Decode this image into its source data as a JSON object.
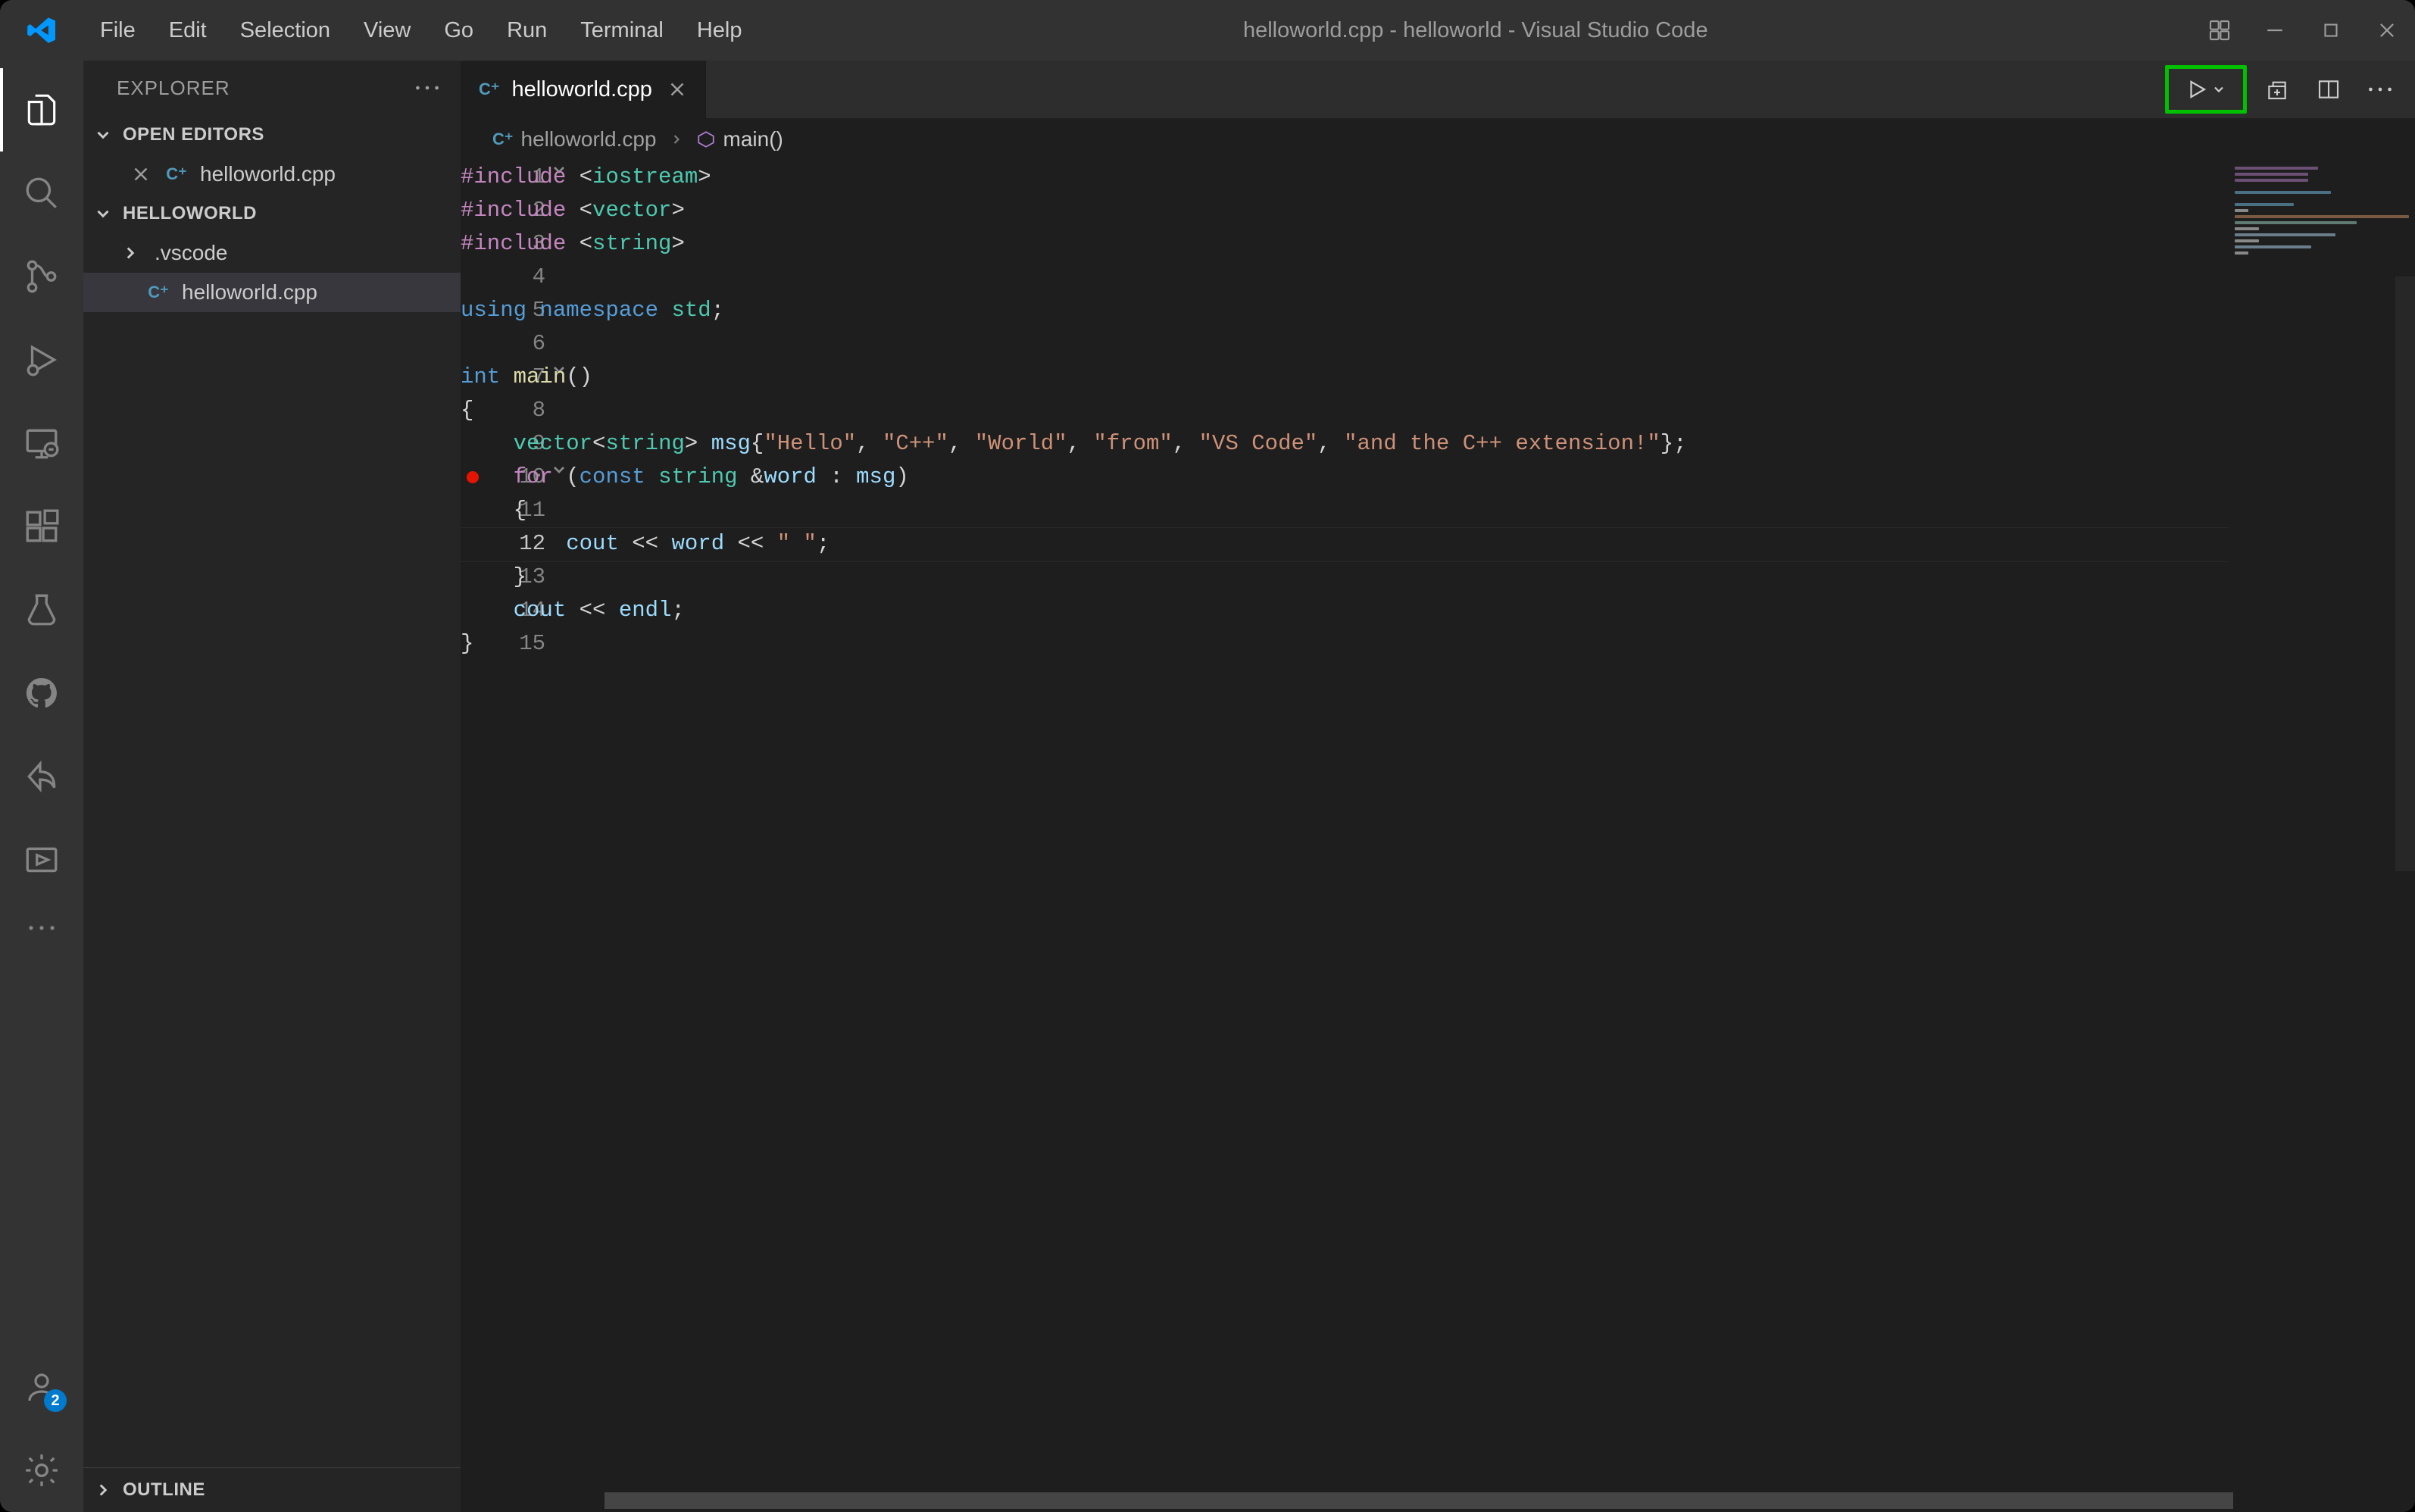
{
  "window": {
    "title": "helloworld.cpp - helloworld - Visual Studio Code"
  },
  "menu": {
    "items": [
      "File",
      "Edit",
      "Selection",
      "View",
      "Go",
      "Run",
      "Terminal",
      "Help"
    ]
  },
  "activity": {
    "items": [
      {
        "id": "explorer",
        "label": "Explorer",
        "active": true
      },
      {
        "id": "search",
        "label": "Search"
      },
      {
        "id": "scm",
        "label": "Source Control"
      },
      {
        "id": "run",
        "label": "Run and Debug"
      },
      {
        "id": "remote",
        "label": "Remote Explorer"
      },
      {
        "id": "extensions",
        "label": "Extensions"
      },
      {
        "id": "testing",
        "label": "Testing"
      },
      {
        "id": "github",
        "label": "GitHub"
      },
      {
        "id": "liveshare",
        "label": "Live Share"
      },
      {
        "id": "project",
        "label": "Project Manager"
      }
    ],
    "overflow_label": "...",
    "accounts_badge": "2"
  },
  "explorer": {
    "title": "EXPLORER",
    "open_editors_label": "OPEN EDITORS",
    "open_editors": [
      {
        "name": "helloworld.cpp",
        "icon": "cpp"
      }
    ],
    "workspace_label": "HELLOWORLD",
    "tree": [
      {
        "type": "folder",
        "name": ".vscode",
        "expanded": false
      },
      {
        "type": "file",
        "name": "helloworld.cpp",
        "icon": "cpp",
        "selected": true
      }
    ],
    "outline_label": "OUTLINE"
  },
  "tabs": {
    "open": [
      {
        "name": "helloworld.cpp",
        "icon": "cpp",
        "active": true
      }
    ]
  },
  "breadcrumb": {
    "file": "helloworld.cpp",
    "symbol": "main()"
  },
  "editor": {
    "current_line": 12,
    "breakpoint_hover_line": 10,
    "lines": [
      {
        "n": 1,
        "fold": "v",
        "tokens": [
          [
            "ctrl",
            "#include "
          ],
          [
            "op",
            "<"
          ],
          [
            "type",
            "iostream"
          ],
          [
            "op",
            ">"
          ]
        ]
      },
      {
        "n": 2,
        "tokens": [
          [
            "ctrl",
            "#include "
          ],
          [
            "op",
            "<"
          ],
          [
            "type",
            "vector"
          ],
          [
            "op",
            ">"
          ]
        ]
      },
      {
        "n": 3,
        "tokens": [
          [
            "ctrl",
            "#include "
          ],
          [
            "op",
            "<"
          ],
          [
            "type",
            "string"
          ],
          [
            "op",
            ">"
          ]
        ]
      },
      {
        "n": 4,
        "tokens": []
      },
      {
        "n": 5,
        "tokens": [
          [
            "kw",
            "using "
          ],
          [
            "kw",
            "namespace "
          ],
          [
            "type",
            "std"
          ],
          [
            "op",
            ";"
          ]
        ]
      },
      {
        "n": 6,
        "tokens": []
      },
      {
        "n": 7,
        "fold": "v",
        "tokens": [
          [
            "kw",
            "int "
          ],
          [
            "fn",
            "main"
          ],
          [
            "op",
            "()"
          ]
        ]
      },
      {
        "n": 8,
        "tokens": [
          [
            "op",
            "{"
          ]
        ]
      },
      {
        "n": 9,
        "tokens": [
          [
            "op",
            "    "
          ],
          [
            "type",
            "vector"
          ],
          [
            "op",
            "<"
          ],
          [
            "type",
            "string"
          ],
          [
            "op",
            "> "
          ],
          [
            "var",
            "msg"
          ],
          [
            "op",
            "{"
          ],
          [
            "str",
            "\"Hello\""
          ],
          [
            "op",
            ", "
          ],
          [
            "str",
            "\"C++\""
          ],
          [
            "op",
            ", "
          ],
          [
            "str",
            "\"World\""
          ],
          [
            "op",
            ", "
          ],
          [
            "str",
            "\"from\""
          ],
          [
            "op",
            ", "
          ],
          [
            "str",
            "\"VS Code\""
          ],
          [
            "op",
            ", "
          ],
          [
            "str",
            "\"and the C++ extension!\""
          ],
          [
            "op",
            "};"
          ]
        ]
      },
      {
        "n": 10,
        "fold": "v",
        "tokens": [
          [
            "op",
            "    "
          ],
          [
            "ctrl",
            "for "
          ],
          [
            "op",
            "("
          ],
          [
            "cst",
            "const "
          ],
          [
            "type",
            "string "
          ],
          [
            "op",
            "&"
          ],
          [
            "var",
            "word"
          ],
          [
            "op",
            " : "
          ],
          [
            "var",
            "msg"
          ],
          [
            "op",
            ")"
          ]
        ]
      },
      {
        "n": 11,
        "tokens": [
          [
            "op",
            "    {"
          ]
        ]
      },
      {
        "n": 12,
        "tokens": [
          [
            "op",
            "        "
          ],
          [
            "var",
            "cout"
          ],
          [
            "op",
            " << "
          ],
          [
            "var",
            "word"
          ],
          [
            "op",
            " << "
          ],
          [
            "str",
            "\" \""
          ],
          [
            "op",
            ";"
          ]
        ]
      },
      {
        "n": 13,
        "tokens": [
          [
            "op",
            "    }"
          ]
        ]
      },
      {
        "n": 14,
        "tokens": [
          [
            "op",
            "    "
          ],
          [
            "var",
            "cout"
          ],
          [
            "op",
            " << "
          ],
          [
            "var",
            "endl"
          ],
          [
            "op",
            ";"
          ]
        ]
      },
      {
        "n": 15,
        "tokens": [
          [
            "op",
            "}"
          ]
        ]
      }
    ]
  }
}
